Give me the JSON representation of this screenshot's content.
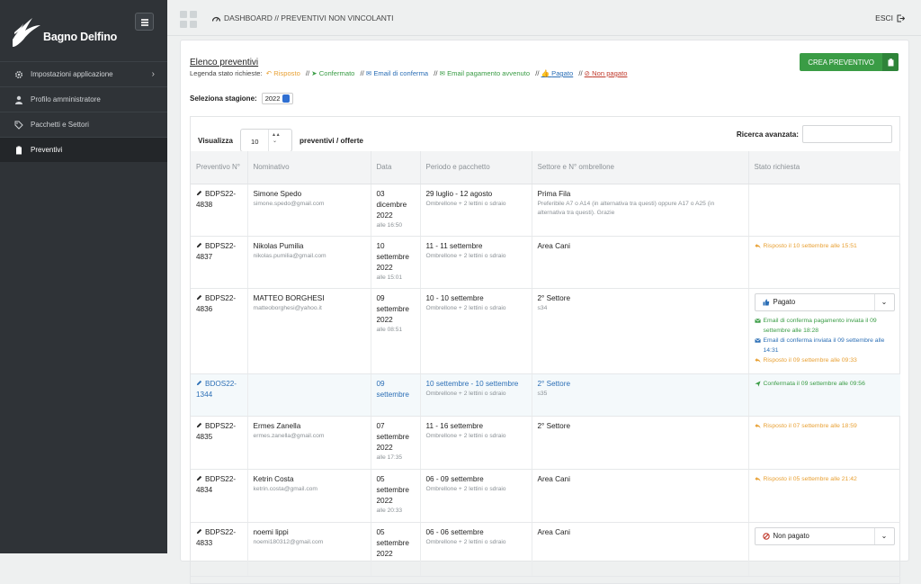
{
  "app": {
    "name": "Bagno Delfino"
  },
  "sidebar": {
    "items": [
      {
        "label": "Impostazioni applicazione",
        "icon": "gear-icon",
        "has_submenu": true
      },
      {
        "label": "Profilo amministratore",
        "icon": "user-icon",
        "has_submenu": false
      },
      {
        "label": "Pacchetti e Settori",
        "icon": "tags-icon",
        "has_submenu": false
      },
      {
        "label": "Preventivi",
        "icon": "clipboard-icon",
        "active": true,
        "has_submenu": false
      }
    ]
  },
  "topbar": {
    "breadcrumb": "DASHBOARD // PREVENTIVI NON VINCOLANTI",
    "logout": "ESCI"
  },
  "panel": {
    "title": "Elenco preventivi",
    "legend_intro": "Legenda stato richieste:",
    "legend": [
      {
        "label": "Risposto",
        "color": "#e8a033",
        "icon": "reply-icon"
      },
      {
        "label": "Confermato",
        "color": "#3a9c45",
        "icon": "send-icon"
      },
      {
        "label": "Email di conferma",
        "color": "#2c6fb6",
        "icon": "envelope-icon"
      },
      {
        "label": "Email pagamento avvenuto",
        "color": "#3a9c45",
        "icon": "envelope-icon"
      },
      {
        "label": "Pagato",
        "color": "#2c6fb6",
        "icon": "thumbs-up-icon"
      },
      {
        "label": "Non pagato",
        "color": "#c0392b",
        "icon": "ban-icon"
      }
    ],
    "create_button": "CREA PREVENTIVO",
    "season_label": "Seleziona stagione:",
    "season_value": "2022",
    "show_label": "Visualizza",
    "show_value": "10",
    "show_suffix": "preventivi / offerte",
    "search_label": "Ricerca avanzata:"
  },
  "table": {
    "headers": [
      "Preventivo N°",
      "Nominativo",
      "Data",
      "Periodo e pacchetto",
      "Settore e N° ombrellone",
      "Stato richiesta"
    ],
    "rows": [
      {
        "id": "BDPS22-4838",
        "name": "Simone Spedo",
        "email": "simone.spedo@gmail.com",
        "date": "03 dicembre 2022",
        "time": "alle 16:50",
        "period": "29 luglio - 12 agosto",
        "package": "Ombrellone + 2 lettini o sdraio",
        "sector": "Prima Fila",
        "sector_note": "Preferibile A7 o A14 (in alternativa tra questi) oppure A17 o A25 (in alternativa tra questi). Grazie",
        "dropdown": "",
        "status": []
      },
      {
        "id": "BDPS22-4837",
        "name": "Nikolas Pumilia",
        "email": "nikolas.pumilia@gmail.com",
        "date": "10 settembre 2022",
        "time": "alle 15:01",
        "period": "11 - 11 settembre",
        "package": "Ombrellone + 2 lettini o sdraio",
        "sector": "Area Cani",
        "sector_note": "",
        "dropdown": "",
        "status": [
          {
            "text": "Risposto il 10 settembre alle 15:51",
            "type": "risposto"
          }
        ]
      },
      {
        "id": "BDPS22-4836",
        "name": "MATTEO BORGHESI",
        "email": "matteoborghesi@yahoo.it",
        "date": "09 settembre 2022",
        "time": "alle 08:51",
        "period": "10 - 10 settembre",
        "package": "Ombrellone + 2 lettini o sdraio",
        "sector": "2° Settore",
        "sector_note": "s34",
        "dropdown": "Pagato",
        "status": [
          {
            "text": "Email di conferma pagamento inviata il 09 settembre alle 18:28",
            "type": "pagamento"
          },
          {
            "text": "Email di conferma inviata il 09 settembre alle 14:31",
            "type": "email"
          },
          {
            "text": "Risposto il 09 settembre alle 09:33",
            "type": "risposto"
          }
        ]
      },
      {
        "id": "BDOS22-1344",
        "name": "",
        "email": "",
        "date": "09 settembre",
        "time": "",
        "period": "10 settembre - 10 settembre",
        "package": "Ombrellone + 2 lettini o sdraio",
        "sector": "2° Settore",
        "sector_note": "s35",
        "dropdown": "",
        "highlight": true,
        "status": [
          {
            "text": "Confermata il 09 settembre alle 09:56",
            "type": "confermato"
          }
        ]
      },
      {
        "id": "BDPS22-4835",
        "name": "Ermes Zanella",
        "email": "ermes.zanella@gmail.com",
        "date": "07 settembre 2022",
        "time": "alle 17:35",
        "period": "11 - 16 settembre",
        "package": "Ombrellone + 2 lettini o sdraio",
        "sector": "2° Settore",
        "sector_note": "",
        "dropdown": "",
        "status": [
          {
            "text": "Risposto il 07 settembre alle 18:59",
            "type": "risposto"
          }
        ]
      },
      {
        "id": "BDPS22-4834",
        "name": "Ketrin Costa",
        "email": "ketrin.costa@gmail.com",
        "date": "05 settembre 2022",
        "time": "alle 20:33",
        "period": "06 - 09 settembre",
        "package": "Ombrellone + 2 lettini o sdraio",
        "sector": "Area Cani",
        "sector_note": "",
        "dropdown": "",
        "status": [
          {
            "text": "Risposto il 05 settembre alle 21:42",
            "type": "risposto"
          }
        ]
      },
      {
        "id": "BDPS22-4833",
        "name": "noemi lippi",
        "email": "noemi180312@gmail.com",
        "date": "05 settembre 2022",
        "time": "",
        "period": "06 - 06 settembre",
        "package": "Ombrellone + 2 lettini o sdraio",
        "sector": "Area Cani",
        "sector_note": "",
        "dropdown": "Non pagato",
        "status": []
      }
    ]
  }
}
